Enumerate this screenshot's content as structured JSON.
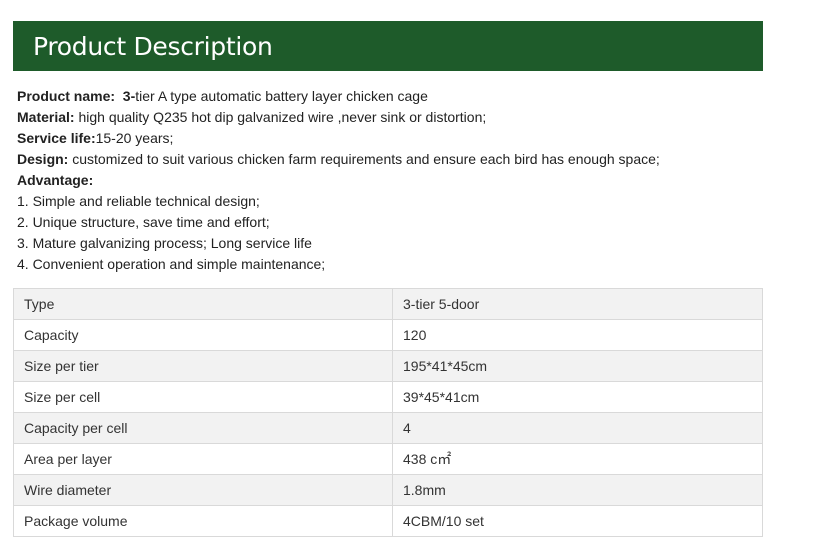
{
  "header": {
    "title": "Product Description"
  },
  "description": {
    "product_name": {
      "label": "Product name:",
      "emph": "3-",
      "value": "tier A type automatic battery layer chicken cage"
    },
    "material": {
      "label": "Material:",
      "value": "high quality Q235 hot dip galvanized wire ,never sink or distortion;"
    },
    "service_life": {
      "label": "Service life:",
      "value": "15-20 years;"
    },
    "design": {
      "label": "Design:",
      "value": "customized to suit various chicken farm requirements and ensure each bird has enough space;"
    },
    "advantage": {
      "label": "Advantage:",
      "items": [
        "1. Simple and reliable technical design;",
        "2. Unique structure, save time and effort;",
        "3. Mature galvanizing process; Long service life",
        "4. Convenient operation and simple maintenance;"
      ]
    }
  },
  "specs": [
    {
      "key": "Type",
      "value": "3-tier 5-door"
    },
    {
      "key": "Capacity",
      "value": "120"
    },
    {
      "key": "Size per tier",
      "value": "195*41*45cm"
    },
    {
      "key": "Size per cell",
      "value": "39*45*41cm"
    },
    {
      "key": "Capacity per cell",
      "value": "4"
    },
    {
      "key": "Area per layer",
      "value": "438 c㎡"
    },
    {
      "key": "Wire diameter",
      "value": "1.8mm"
    },
    {
      "key": "Package volume",
      "value": "4CBM/10 set"
    }
  ]
}
